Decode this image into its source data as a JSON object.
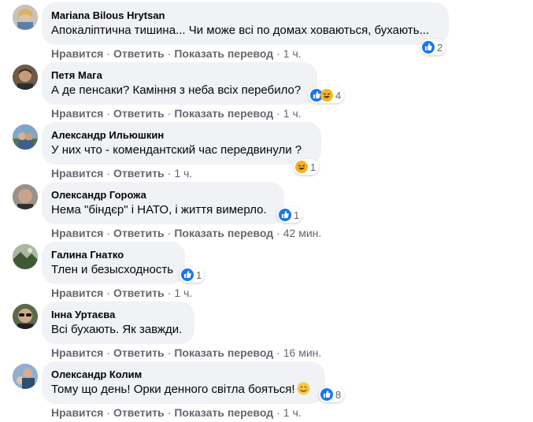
{
  "labels": {
    "like": "Нравится",
    "reply": "Ответить",
    "translate": "Показать перевод",
    "dot": "·"
  },
  "colors": {
    "bubble": "#f0f2f5",
    "like_blue": "#1877f2",
    "meta_gray": "#65676b",
    "haha_yellow": "#f7b125"
  },
  "comments": [
    {
      "author": "Mariana Bilous Hrytsan",
      "text": "Апокаліптична тишина... Чи може всі по домах ховаються, бухають...",
      "reactions": [
        "like"
      ],
      "count": "2",
      "time": "1 ч.",
      "show_translate": true,
      "avatar": "woman-photo-avatar"
    },
    {
      "author": "Петя Мага",
      "text": "А де пенсаки? Каміння з неба всіх перебило?",
      "reactions": [
        "like",
        "haha"
      ],
      "count": "4",
      "time": "1 ч.",
      "show_translate": true,
      "avatar": "man-photo-avatar"
    },
    {
      "author": "Александр Ильюшкин",
      "text": "У них что - комендантский час передвинули ?",
      "reactions": [
        "haha"
      ],
      "count": "1",
      "time": "1 ч.",
      "show_translate": false,
      "avatar": "outdoor-photo-avatar"
    },
    {
      "author": "Олександр Горожа",
      "text": "Нема \"біндєр\" і НАТО, і життя вимерло.",
      "reactions": [
        "like"
      ],
      "count": "1",
      "time": "42 мин.",
      "show_translate": true,
      "avatar": "bald-man-avatar"
    },
    {
      "author": "Галина Гнатко",
      "text": "Тлен и безысходность",
      "reactions": [
        "like"
      ],
      "count": "1",
      "time": "1 ч.",
      "show_translate": false,
      "avatar": "landscape-avatar"
    },
    {
      "author": "Інна Уртаєва",
      "text": "Всі бухають. Як завжди.",
      "reactions": [],
      "count": "",
      "time": "16 мин.",
      "show_translate": true,
      "avatar": "sunglasses-avatar"
    },
    {
      "author": "Олександр Колим",
      "text": "Тому що день! Орки денного світла бояться!",
      "reactions": [
        "like"
      ],
      "count": "8",
      "time": "1 ч.",
      "show_translate": true,
      "avatar": "man-child-avatar",
      "trailing_emoji": "smiling-face-emoji"
    }
  ]
}
